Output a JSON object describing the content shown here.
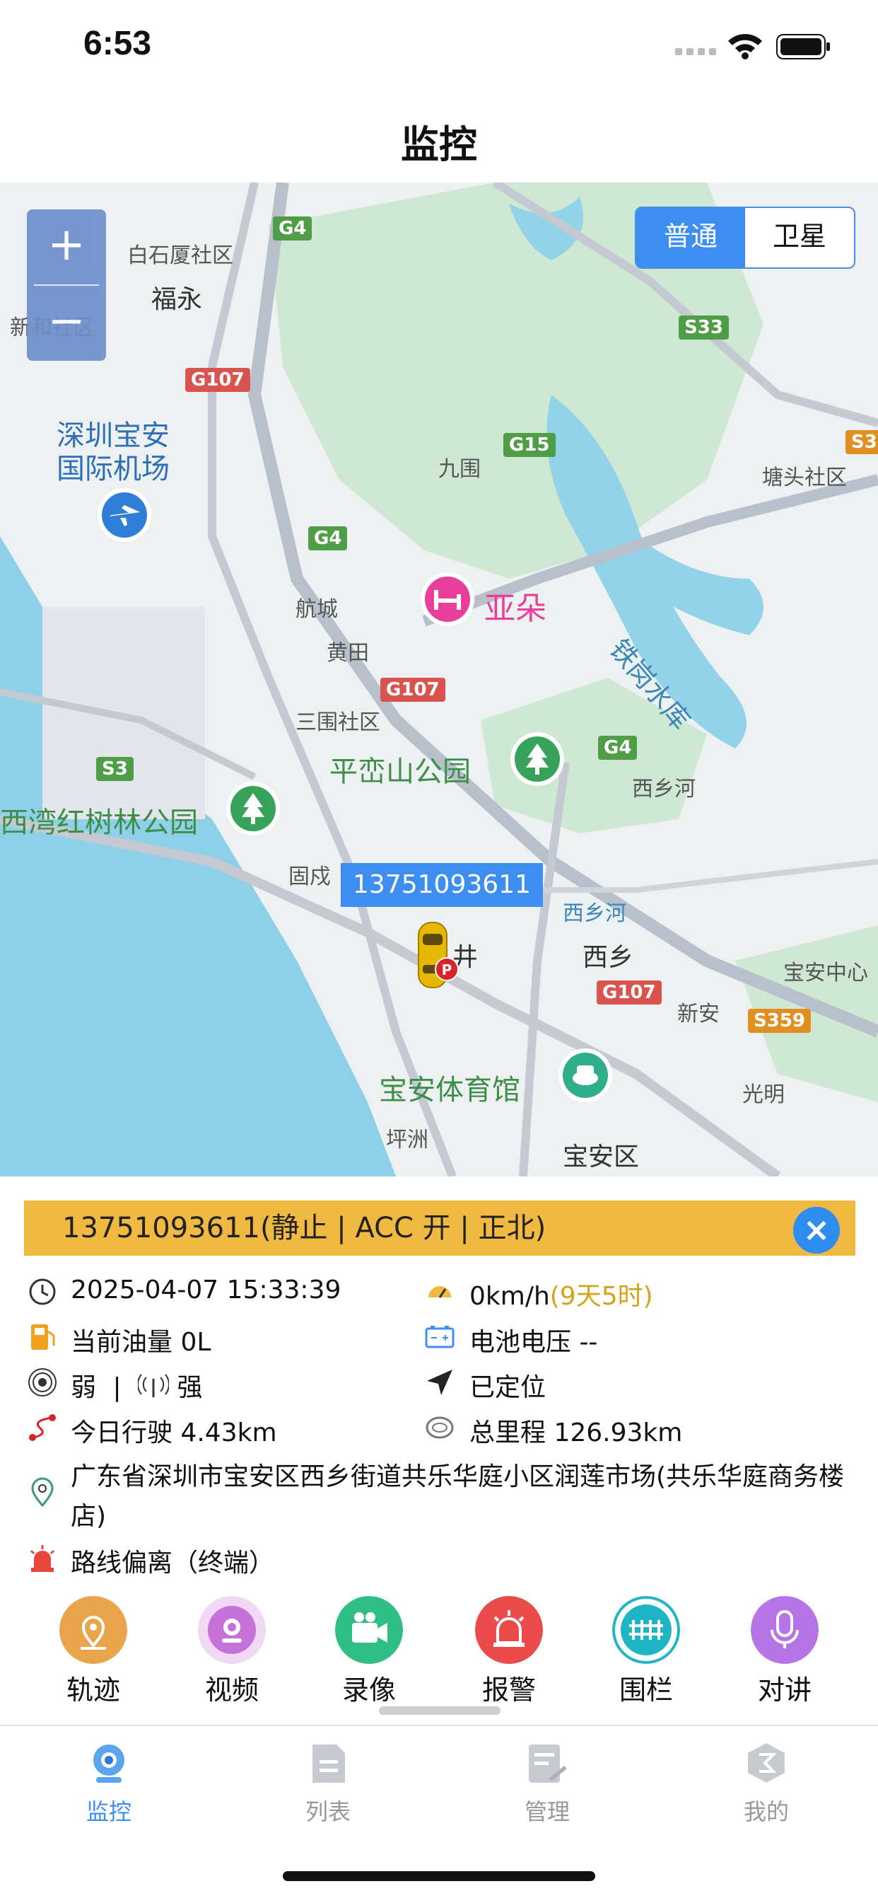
{
  "status_bar": {
    "time": "6:53"
  },
  "nav": {
    "title": "监控"
  },
  "map": {
    "zoom_in": "+",
    "zoom_out": "−",
    "type_normal": "普通",
    "type_satellite": "卫星",
    "vehicle_label": "13751093611",
    "labels": {
      "baiwuhsia": "白石厦社区",
      "fuyong": "福永",
      "xinhe": "新和社区",
      "airport_1": "深圳宝安",
      "airport_2": "国际机场",
      "jiuwei": "九围",
      "tangtou": "塘头社区",
      "hangcheng": "航城",
      "yaduo": "亚朵",
      "huangtian": "黄田",
      "sanwei": "三围社区",
      "tieshui": "铁岗水库",
      "pingluanshan": "平峦山公园",
      "xixianghe_top": "西乡河",
      "xiwan": "西湾红树林公园",
      "guxu": "固戍",
      "xixianghe": "西乡河",
      "jing": "井",
      "xixiang": "西乡",
      "baoanzhongxin": "宝安中心",
      "xinan": "新安",
      "guangming": "光明",
      "tiyuguan": "宝安体育馆",
      "pingzhou": "坪洲",
      "baoanqu": "宝安区"
    },
    "shields": {
      "g4_a": "G4",
      "g107_a": "G107",
      "s33": "S33",
      "g15": "G15",
      "s3_r": "S3",
      "g4_b": "G4",
      "g107_b": "G107",
      "g4_c": "G4",
      "s3": "S3",
      "g107_c": "G107",
      "s359": "S359"
    }
  },
  "info": {
    "title": "13751093611(静止 | ACC 开 | 正北)",
    "time": "2025-04-07 15:33:39",
    "speed": "0km/h",
    "duration": "(9天5时)",
    "fuel": "当前油量 0L",
    "battery": "电池电压 --",
    "signal_weak": "弱",
    "signal_sep": "|",
    "signal_strong": "强",
    "located": "已定位",
    "today_distance": "今日行驶 4.43km",
    "total_distance": "总里程 126.93km",
    "address": "广东省深圳市宝安区西乡街道共乐华庭小区润莲市场(共乐华庭商务楼店)",
    "alarm": "路线偏离（终端）"
  },
  "actions": {
    "track": "轨迹",
    "video": "视频",
    "record": "录像",
    "alarm": "报警",
    "fence": "围栏",
    "talk": "对讲"
  },
  "tabs": {
    "monitor": "监控",
    "list": "列表",
    "manage": "管理",
    "mine": "我的"
  },
  "colors": {
    "accent": "#3d8ef0",
    "banner": "#f0b941",
    "duration": "#d6a21a"
  }
}
